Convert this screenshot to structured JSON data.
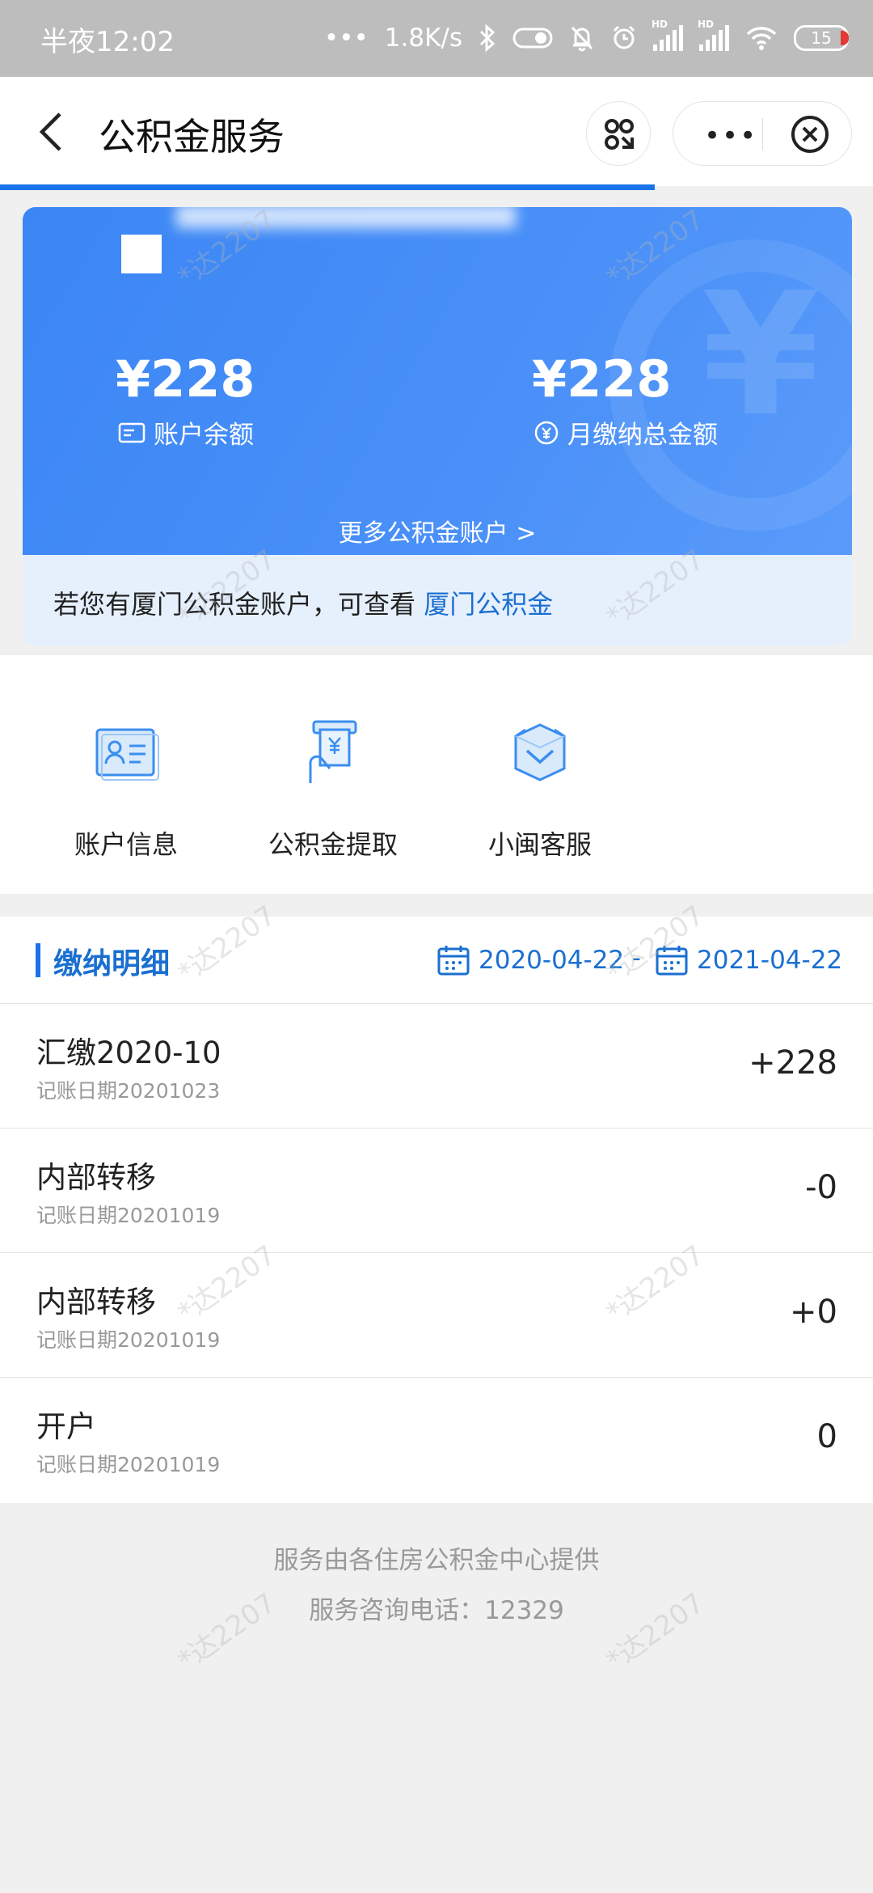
{
  "status_bar": {
    "time": "半夜12:02",
    "net_speed": "1.8K/s",
    "battery": "15"
  },
  "nav": {
    "title": "公积金服务",
    "more_label": "•••"
  },
  "card": {
    "balance_amount": "¥228",
    "balance_label": "账户余额",
    "monthly_amount": "¥228",
    "monthly_label": "月缴纳总金额",
    "more_accounts": "更多公积金账户 >"
  },
  "notice": {
    "text": "若您有厦门公积金账户，可查看",
    "link": "厦门公积金"
  },
  "menu": [
    {
      "label": "账户信息",
      "icon": "id-card-icon"
    },
    {
      "label": "公积金提取",
      "icon": "withdraw-icon"
    },
    {
      "label": "小闽客服",
      "icon": "customer-service-icon"
    }
  ],
  "records": {
    "title": "缴纳明细",
    "date_from": "2020-04-22",
    "date_separator": "-",
    "date_to": "2021-04-22",
    "rows": [
      {
        "name": "汇缴2020-10",
        "date": "记账日期20201023",
        "amount": "+228"
      },
      {
        "name": "内部转移",
        "date": "记账日期20201019",
        "amount": "-0"
      },
      {
        "name": "内部转移",
        "date": "记账日期20201019",
        "amount": "+0"
      },
      {
        "name": "开户",
        "date": "记账日期20201019",
        "amount": "0"
      }
    ]
  },
  "footer": {
    "line1": "服务由各住房公积金中心提供",
    "line2": "服务咨询电话：12329"
  },
  "watermark": "*达2207",
  "colors": {
    "accent": "#1a73e8",
    "link": "#1a6fd1",
    "card_blue": "#4a90f8"
  }
}
